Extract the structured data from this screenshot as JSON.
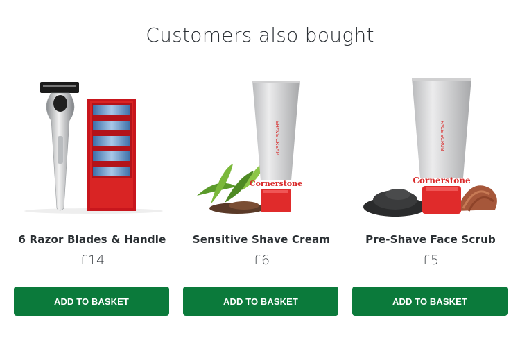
{
  "section": {
    "heading": "Customers also bought"
  },
  "products": [
    {
      "name": "6 Razor Blades & Handle",
      "price": "£14",
      "button": "ADD TO BASKET"
    },
    {
      "name": "Sensitive Shave Cream",
      "price": "£6",
      "button": "ADD TO BASKET",
      "tube_brand": "Cornerstone",
      "tube_text": "SHAVE CREAM"
    },
    {
      "name": "Pre-Shave Face Scrub",
      "price": "£5",
      "button": "ADD TO BASKET",
      "tube_brand": "Cornerstone",
      "tube_text": "FACE SCRUB"
    }
  ],
  "colors": {
    "button": "#0b7a3b",
    "brand_red": "#d92a2a"
  }
}
